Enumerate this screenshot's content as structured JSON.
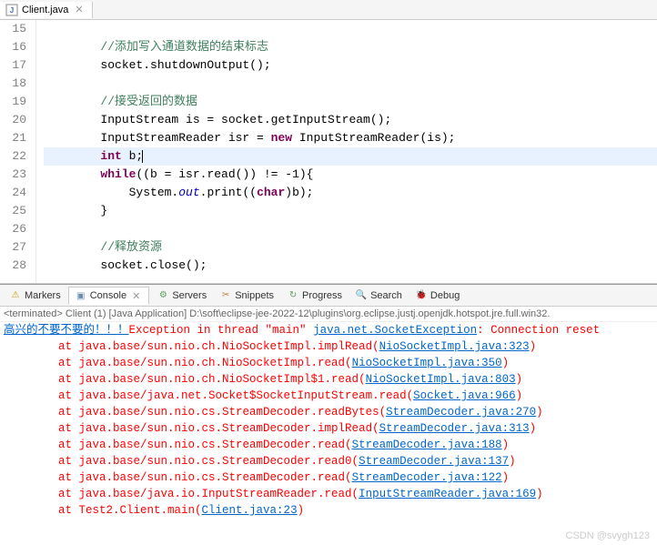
{
  "tab": {
    "filename": "Client.java",
    "close": "✕"
  },
  "lines": [
    {
      "n": 15,
      "hl": false,
      "segs": [
        [
          "        ",
          "p"
        ]
      ]
    },
    {
      "n": 16,
      "hl": false,
      "segs": [
        [
          "        ",
          "p"
        ],
        [
          "//添加写入通道数据的结束标志",
          "cmt"
        ]
      ]
    },
    {
      "n": 17,
      "hl": false,
      "segs": [
        [
          "        socket.shutdownOutput();",
          "p"
        ]
      ]
    },
    {
      "n": 18,
      "hl": false,
      "segs": [
        [
          "",
          "p"
        ]
      ]
    },
    {
      "n": 19,
      "hl": false,
      "segs": [
        [
          "        ",
          "p"
        ],
        [
          "//接受返回的数据",
          "cmt"
        ]
      ]
    },
    {
      "n": 20,
      "hl": false,
      "segs": [
        [
          "        InputStream is = socket.getInputStream();",
          "p"
        ]
      ]
    },
    {
      "n": 21,
      "hl": false,
      "segs": [
        [
          "        InputStreamReader isr = ",
          "p"
        ],
        [
          "new",
          "kw"
        ],
        [
          " InputStreamReader(is);",
          "p"
        ]
      ]
    },
    {
      "n": 22,
      "hl": true,
      "segs": [
        [
          "        ",
          "p"
        ],
        [
          "int",
          "kw"
        ],
        [
          " b;",
          "p"
        ]
      ],
      "caret": true
    },
    {
      "n": 23,
      "hl": false,
      "segs": [
        [
          "        ",
          "p"
        ],
        [
          "while",
          "kw"
        ],
        [
          "((b = isr.read()) != -1){",
          "p"
        ]
      ]
    },
    {
      "n": 24,
      "hl": false,
      "segs": [
        [
          "            System.",
          "p"
        ],
        [
          "out",
          "fld"
        ],
        [
          ".print((",
          "p"
        ],
        [
          "char",
          "kw"
        ],
        [
          ")b);",
          "p"
        ]
      ]
    },
    {
      "n": 25,
      "hl": false,
      "segs": [
        [
          "        }",
          "p"
        ]
      ]
    },
    {
      "n": 26,
      "hl": false,
      "segs": [
        [
          "",
          "p"
        ]
      ]
    },
    {
      "n": 27,
      "hl": false,
      "segs": [
        [
          "        ",
          "p"
        ],
        [
          "//释放资源",
          "cmt"
        ]
      ]
    },
    {
      "n": 28,
      "hl": false,
      "segs": [
        [
          "        socket.close();",
          "p"
        ]
      ]
    }
  ],
  "console_tabs": [
    {
      "icon": "⚠",
      "label": "Markers",
      "color": "#cc9900"
    },
    {
      "icon": "▣",
      "label": "Console",
      "active": true,
      "close": "✕",
      "color": "#6a8caf"
    },
    {
      "icon": "⚙",
      "label": "Servers",
      "color": "#5a9e5a"
    },
    {
      "icon": "✂",
      "label": "Snippets",
      "color": "#c08040"
    },
    {
      "icon": "↻",
      "label": "Progress",
      "color": "#5a9e5a"
    },
    {
      "icon": "🔍",
      "label": "Search",
      "color": "#cc9900"
    },
    {
      "icon": "🐞",
      "label": "Debug",
      "color": "#5a9e5a"
    }
  ],
  "console_header": "<terminated> Client (1) [Java Application] D:\\soft\\eclipse-jee-2022-12\\plugins\\org.eclipse.justj.openjdk.hotspot.jre.full.win32.",
  "console_lines": [
    {
      "segs": [
        [
          "高兴的不要不要的！！！",
          "user-out"
        ],
        [
          "Exception",
          "err"
        ],
        [
          " in thread \"main\" ",
          "err"
        ],
        [
          "java.net.SocketException",
          "link"
        ],
        [
          ": Connection reset",
          "err"
        ]
      ]
    },
    {
      "segs": [
        [
          "        at java.base/sun.nio.ch.NioSocketImpl.implRead(",
          "err"
        ],
        [
          "NioSocketImpl.java:323",
          "link"
        ],
        [
          ")",
          "err"
        ]
      ]
    },
    {
      "segs": [
        [
          "        at java.base/sun.nio.ch.NioSocketImpl.read(",
          "err"
        ],
        [
          "NioSocketImpl.java:350",
          "link"
        ],
        [
          ")",
          "err"
        ]
      ]
    },
    {
      "segs": [
        [
          "        at java.base/sun.nio.ch.NioSocketImpl$1.read(",
          "err"
        ],
        [
          "NioSocketImpl.java:803",
          "link"
        ],
        [
          ")",
          "err"
        ]
      ]
    },
    {
      "segs": [
        [
          "        at java.base/java.net.Socket$SocketInputStream.read(",
          "err"
        ],
        [
          "Socket.java:966",
          "link"
        ],
        [
          ")",
          "err"
        ]
      ]
    },
    {
      "segs": [
        [
          "        at java.base/sun.nio.cs.StreamDecoder.readBytes(",
          "err"
        ],
        [
          "StreamDecoder.java:270",
          "link"
        ],
        [
          ")",
          "err"
        ]
      ]
    },
    {
      "segs": [
        [
          "        at java.base/sun.nio.cs.StreamDecoder.implRead(",
          "err"
        ],
        [
          "StreamDecoder.java:313",
          "link"
        ],
        [
          ")",
          "err"
        ]
      ]
    },
    {
      "segs": [
        [
          "        at java.base/sun.nio.cs.StreamDecoder.read(",
          "err"
        ],
        [
          "StreamDecoder.java:188",
          "link"
        ],
        [
          ")",
          "err"
        ]
      ]
    },
    {
      "segs": [
        [
          "        at java.base/sun.nio.cs.StreamDecoder.read0(",
          "err"
        ],
        [
          "StreamDecoder.java:137",
          "link"
        ],
        [
          ")",
          "err"
        ]
      ]
    },
    {
      "segs": [
        [
          "        at java.base/sun.nio.cs.StreamDecoder.read(",
          "err"
        ],
        [
          "StreamDecoder.java:122",
          "link"
        ],
        [
          ")",
          "err"
        ]
      ]
    },
    {
      "segs": [
        [
          "        at java.base/java.io.InputStreamReader.read(",
          "err"
        ],
        [
          "InputStreamReader.java:169",
          "link"
        ],
        [
          ")",
          "err"
        ]
      ]
    },
    {
      "segs": [
        [
          "        at Test2.Client.main(",
          "err"
        ],
        [
          "Client.java:23",
          "link"
        ],
        [
          ")",
          "err"
        ]
      ]
    }
  ],
  "watermark": "CSDN @svygh123"
}
